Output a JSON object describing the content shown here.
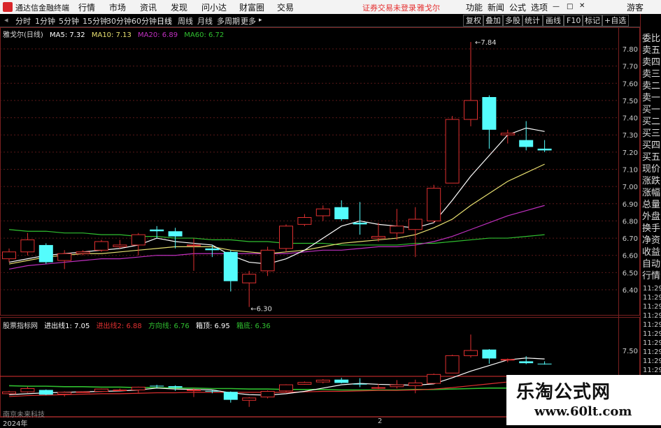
{
  "menu": {
    "app_title": "通达信金融终端",
    "items": [
      "行情",
      "市场",
      "资讯",
      "发现",
      "问小达",
      "财富圈",
      "交易"
    ],
    "notice": "证券交易未登录",
    "stock_name": "雅戈尔",
    "right_items": [
      "功能",
      "新闻",
      "公式",
      "选项"
    ],
    "guest": "游客"
  },
  "toolbar": {
    "periods": [
      "分时",
      "1分钟",
      "5分钟",
      "15分钟",
      "30分钟",
      "60分钟",
      "日线",
      "周线",
      "月线",
      "多周期",
      "更多"
    ],
    "active_period": "日线",
    "buttons": [
      "复权",
      "叠加",
      "多股",
      "统计",
      "画线",
      "F10",
      "标记",
      "+自选"
    ]
  },
  "main_chart": {
    "title": "雅戈尔(日线)",
    "ma_items": [
      {
        "label": "MA5: 7.32",
        "color": "#ffffff"
      },
      {
        "label": "MA10: 7.13",
        "color": "#e8e070"
      },
      {
        "label": "MA20: 6.89",
        "color": "#c030c0"
      },
      {
        "label": "MA60: 6.72",
        "color": "#30c030"
      }
    ],
    "high_label": "7.84",
    "low_label": "6.30",
    "y_ticks": [
      "7.80",
      "7.70",
      "7.60",
      "7.50",
      "7.40",
      "7.30",
      "7.20",
      "7.10",
      "7.00",
      "6.90",
      "6.80",
      "6.70",
      "6.60",
      "6.50",
      "6.40"
    ]
  },
  "sub_chart": {
    "title": "股票指标网",
    "items": [
      {
        "label": "进出线1: 7.05",
        "color": "#ffffff"
      },
      {
        "label": "进出线2: 6.88",
        "color": "#e03030"
      },
      {
        "label": "方向线: 6.76",
        "color": "#30c030"
      },
      {
        "label": "箱顶: 6.95",
        "color": "#ffffff"
      },
      {
        "label": "箱底: 6.36",
        "color": "#30c030"
      }
    ],
    "y_tick": "7.50",
    "bottom_text": "南京未来科技"
  },
  "axis": {
    "year_label": "2024年",
    "month_label": "2"
  },
  "right_panel": {
    "labels": [
      "委比",
      "卖五",
      "卖四",
      "卖三",
      "卖二",
      "卖一",
      "买一",
      "买二",
      "买三",
      "买四",
      "买五",
      "现价",
      "涨跌",
      "涨幅",
      "总量",
      "外盘",
      "换手",
      "净资",
      "收益",
      "自动",
      "行情"
    ],
    "times": [
      "11:29",
      "11:29",
      "11:29",
      "11:29",
      "11:29",
      "11:29",
      "11:29",
      "11:29",
      "11:29",
      "11:29",
      "11:29",
      "11:29"
    ]
  },
  "watermark": {
    "title": "乐淘公式网",
    "url": "www.60lt.com"
  },
  "colors": {
    "up": "#e03030",
    "down": "#54fcfc",
    "ma5": "#ffffff",
    "ma10": "#e8e070",
    "ma20": "#c030c0",
    "ma60": "#30c030"
  },
  "chart_data": {
    "type": "candlestick",
    "candles": [
      {
        "o": 6.58,
        "c": 6.62,
        "h": 6.64,
        "l": 6.56
      },
      {
        "o": 6.62,
        "c": 6.69,
        "h": 6.73,
        "l": 6.6
      },
      {
        "o": 6.66,
        "c": 6.56,
        "h": 6.67,
        "l": 6.55
      },
      {
        "o": 6.57,
        "c": 6.61,
        "h": 6.63,
        "l": 6.52
      },
      {
        "o": 6.61,
        "c": 6.62,
        "h": 6.63,
        "l": 6.6
      },
      {
        "o": 6.63,
        "c": 6.68,
        "h": 6.69,
        "l": 6.62
      },
      {
        "o": 6.65,
        "c": 6.66,
        "h": 6.69,
        "l": 6.64
      },
      {
        "o": 6.66,
        "c": 6.72,
        "h": 6.73,
        "l": 6.6
      },
      {
        "o": 6.75,
        "c": 6.74,
        "h": 6.77,
        "l": 6.7
      },
      {
        "o": 6.74,
        "c": 6.71,
        "h": 6.76,
        "l": 6.64
      },
      {
        "o": 6.66,
        "c": 6.66,
        "h": 6.7,
        "l": 6.51
      },
      {
        "o": 6.64,
        "c": 6.63,
        "h": 6.66,
        "l": 6.59
      },
      {
        "o": 6.62,
        "c": 6.45,
        "h": 6.63,
        "l": 6.39
      },
      {
        "o": 6.44,
        "c": 6.49,
        "h": 6.51,
        "l": 6.3
      },
      {
        "o": 6.51,
        "c": 6.63,
        "h": 6.65,
        "l": 6.48
      },
      {
        "o": 6.64,
        "c": 6.77,
        "h": 6.78,
        "l": 6.62
      },
      {
        "o": 6.78,
        "c": 6.82,
        "h": 6.84,
        "l": 6.77
      },
      {
        "o": 6.83,
        "c": 6.87,
        "h": 6.89,
        "l": 6.8
      },
      {
        "o": 6.88,
        "c": 6.81,
        "h": 6.92,
        "l": 6.8
      },
      {
        "o": 6.79,
        "c": 6.78,
        "h": 6.91,
        "l": 6.72
      },
      {
        "o": 6.7,
        "c": 6.71,
        "h": 6.79,
        "l": 6.68
      },
      {
        "o": 6.73,
        "c": 6.77,
        "h": 6.87,
        "l": 6.69
      },
      {
        "o": 6.75,
        "c": 6.81,
        "h": 6.88,
        "l": 6.59
      },
      {
        "o": 6.8,
        "c": 6.99,
        "h": 7.01,
        "l": 6.79
      },
      {
        "o": 7.02,
        "c": 7.39,
        "h": 7.41,
        "l": 7.02
      },
      {
        "o": 7.39,
        "c": 7.5,
        "h": 7.84,
        "l": 7.35
      },
      {
        "o": 7.52,
        "c": 7.33,
        "h": 7.53,
        "l": 7.22
      },
      {
        "o": 7.3,
        "c": 7.31,
        "h": 7.33,
        "l": 7.25
      },
      {
        "o": 7.27,
        "c": 7.23,
        "h": 7.38,
        "l": 7.21
      },
      {
        "o": 7.22,
        "c": 7.21,
        "h": 7.27,
        "l": 7.2
      }
    ],
    "ma5": [
      6.56,
      6.58,
      6.6,
      6.61,
      6.62,
      6.63,
      6.64,
      6.66,
      6.7,
      6.68,
      6.67,
      6.66,
      6.6,
      6.56,
      6.55,
      6.58,
      6.63,
      6.7,
      6.77,
      6.8,
      6.78,
      6.77,
      6.76,
      6.79,
      6.92,
      7.06,
      7.18,
      7.3,
      7.34,
      7.32
    ],
    "ma10": [
      6.55,
      6.57,
      6.59,
      6.6,
      6.61,
      6.61,
      6.62,
      6.63,
      6.64,
      6.65,
      6.65,
      6.65,
      6.63,
      6.62,
      6.61,
      6.62,
      6.63,
      6.65,
      6.67,
      6.68,
      6.69,
      6.7,
      6.72,
      6.76,
      6.81,
      6.89,
      6.96,
      7.03,
      7.08,
      7.13
    ],
    "ma20": [
      6.52,
      6.54,
      6.55,
      6.56,
      6.57,
      6.58,
      6.58,
      6.59,
      6.6,
      6.6,
      6.61,
      6.61,
      6.61,
      6.61,
      6.61,
      6.61,
      6.62,
      6.63,
      6.63,
      6.64,
      6.65,
      6.65,
      6.66,
      6.68,
      6.71,
      6.75,
      6.79,
      6.83,
      6.86,
      6.89
    ],
    "ma60": [
      6.75,
      6.74,
      6.74,
      6.73,
      6.73,
      6.72,
      6.72,
      6.71,
      6.71,
      6.7,
      6.7,
      6.69,
      6.69,
      6.68,
      6.68,
      6.67,
      6.67,
      6.67,
      6.66,
      6.66,
      6.66,
      6.66,
      6.67,
      6.67,
      6.68,
      6.69,
      6.7,
      6.7,
      6.71,
      6.72
    ],
    "ylim": [
      6.3,
      7.84
    ]
  }
}
